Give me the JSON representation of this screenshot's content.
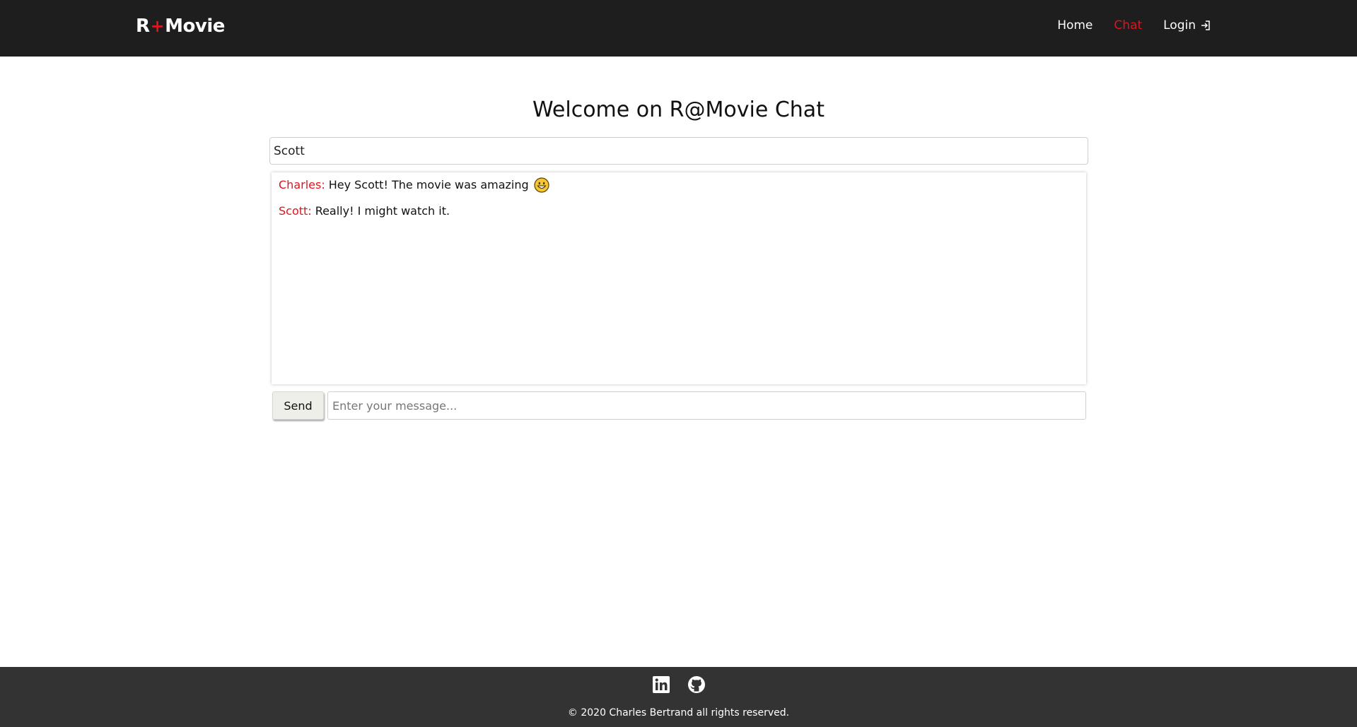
{
  "header": {
    "brand": {
      "left": "R",
      "plus": "+",
      "right": "Movie"
    },
    "nav": [
      {
        "label": "Home",
        "active": false
      },
      {
        "label": "Chat",
        "active": true
      },
      {
        "label": "Login",
        "icon": "login-icon",
        "active": false
      }
    ]
  },
  "main": {
    "title": "Welcome on R@Movie Chat",
    "username_value": "Scott",
    "messages": [
      {
        "author": "Charles:",
        "text": "Hey Scott! The movie was amazing",
        "emoji": "grinning-face-emoji"
      },
      {
        "author": "Scott:",
        "text": "Really! I might watch it.",
        "emoji": ""
      }
    ],
    "send_label": "Send",
    "message_placeholder": "Enter your message..."
  },
  "footer": {
    "icons": [
      "linkedin-icon",
      "github-icon"
    ],
    "copyright": "© 2020 Charles Bertrand all rights reserved."
  },
  "colors": {
    "header_bg": "#1e1e1e",
    "footer_bg": "#333333",
    "accent": "#e0141e"
  }
}
